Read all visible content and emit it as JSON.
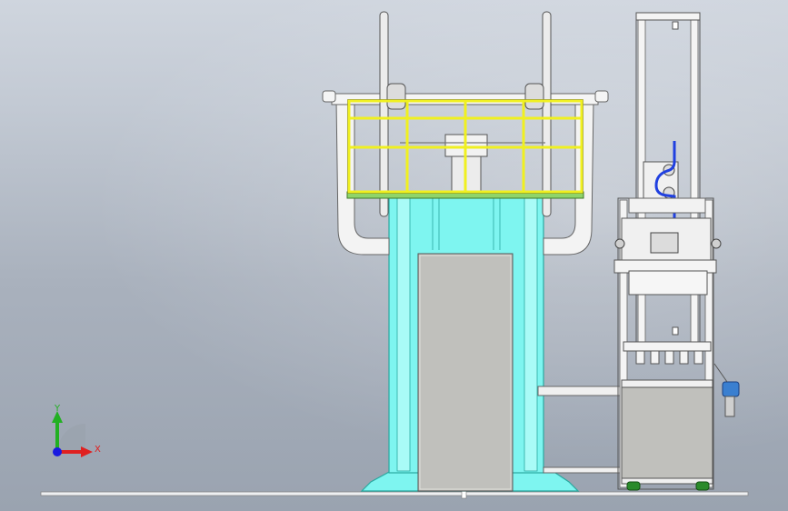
{
  "triad": {
    "x_label": "X",
    "y_label": "Y",
    "x_color": "#e02020",
    "y_color": "#22b022",
    "z_color": "#1a1ae0"
  },
  "colors": {
    "column": "#7ef5f0",
    "column_edge": "#2aa8a0",
    "railing": "#f0f020",
    "platform": "#8fd46a",
    "cabinet": "#c0c0bc",
    "frame": "#f4f4f4",
    "hose": "#2040e0"
  }
}
